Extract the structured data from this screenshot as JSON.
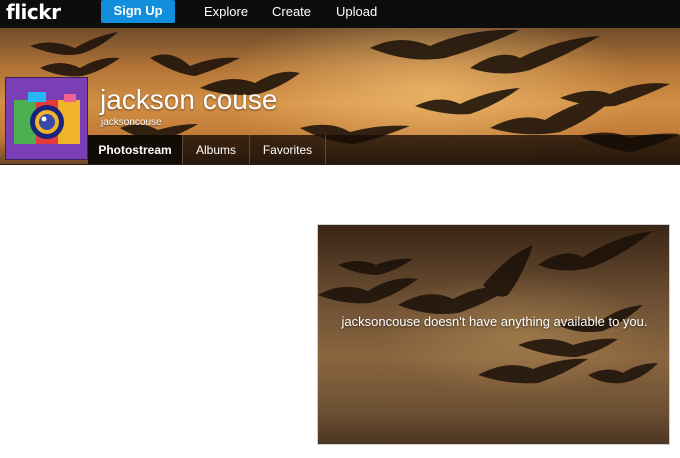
{
  "topbar": {
    "logo": "flickr",
    "signup_label": "Sign Up",
    "nav": [
      "Explore",
      "Create",
      "Upload"
    ]
  },
  "profile": {
    "display_name": "jackson couse",
    "username": "jacksoncouse",
    "tabs": [
      "Photostream",
      "Albums",
      "Favorites"
    ],
    "active_tab": "Photostream"
  },
  "empty_state": {
    "message": "jacksoncouse doesn't have anything available to you."
  },
  "colors": {
    "topbar_bg": "#0d0d0d",
    "signup_bg": "#128fdc",
    "avatar_bg": "#7a3fb5"
  }
}
